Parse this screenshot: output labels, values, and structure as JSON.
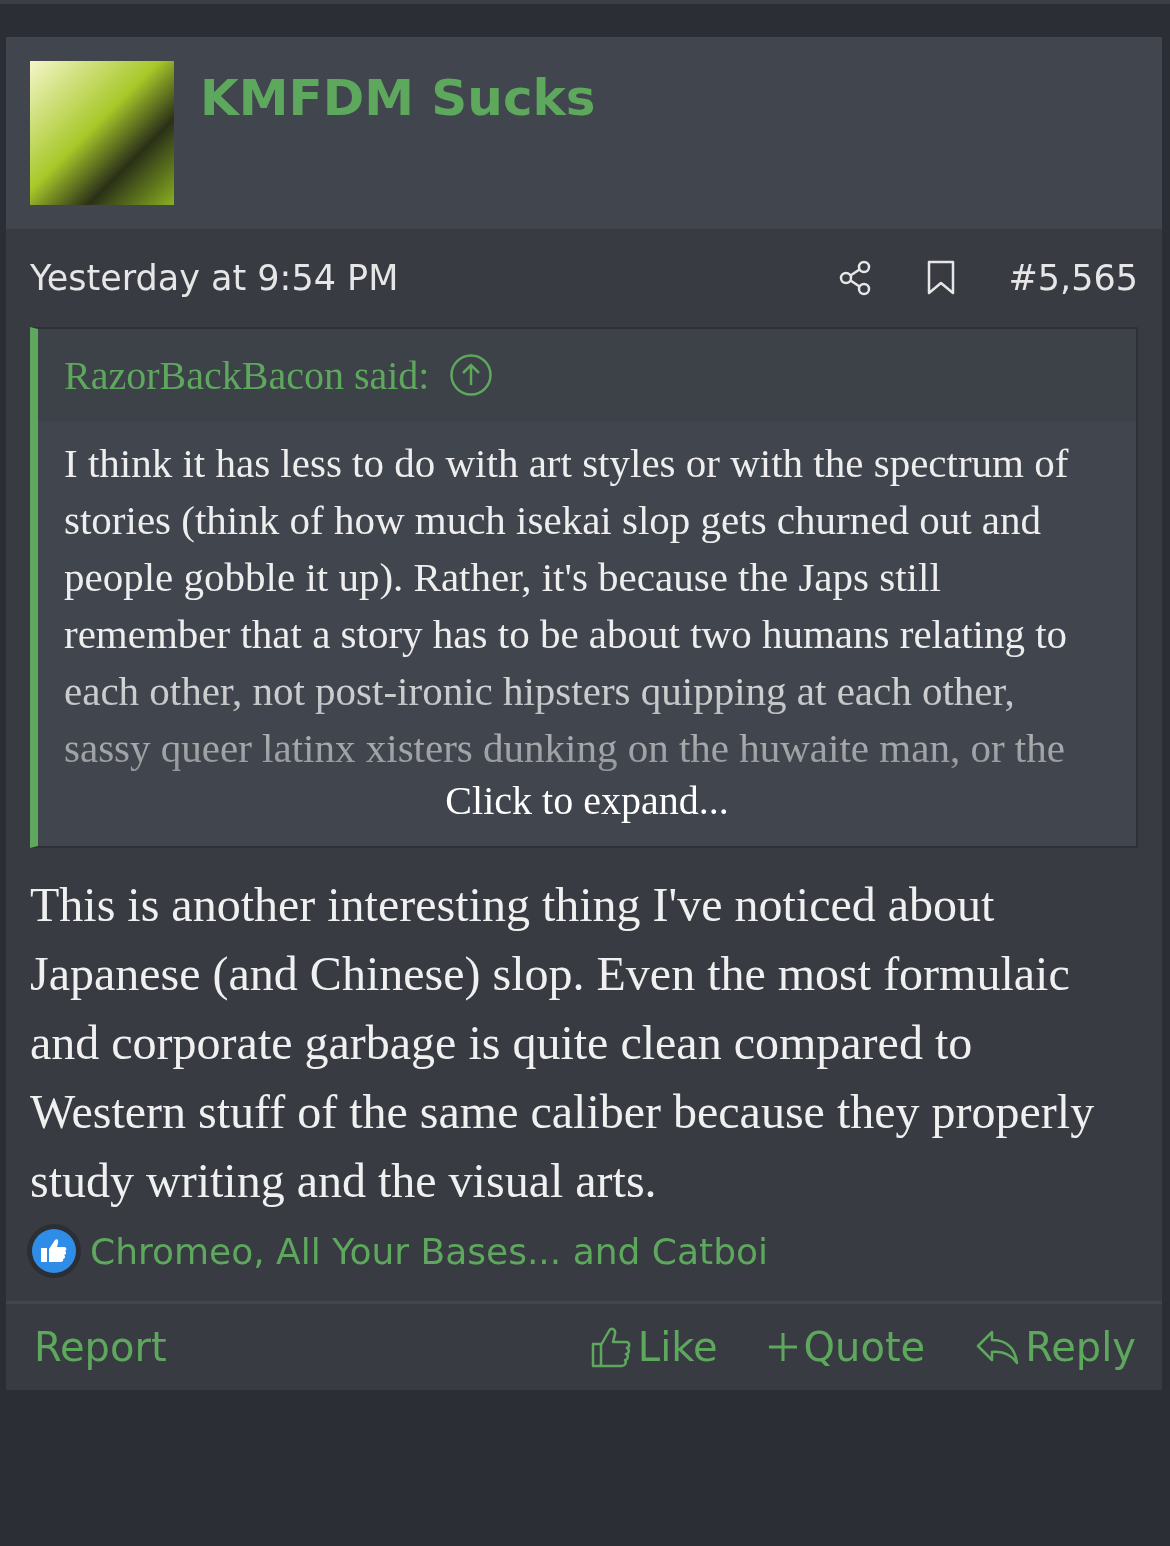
{
  "post": {
    "author": "KMFDM Sucks",
    "time": "Yesterday at 9:54 PM",
    "number": "#5,565",
    "quote": {
      "author": "RazorBackBacon said:",
      "text": "I think it has less to do with art styles or with the spectrum of stories (think of how much isekai slop gets churned out and people gobble it up). Rather, it's because the Japs still remember that a story has to be about two humans relating to each other, not post-ironic hipsters quipping at each other, sassy queer latinx xisters dunking on the huwaite man, or the",
      "expand": "Click to expand..."
    },
    "body": "This is another interesting thing I've noticed about Japanese (and Chinese) slop. Even the most formulaic and corporate garbage is quite clean compared to Western stuff of the same caliber because they properly study writing and the visual arts.",
    "reactions": "Chromeo, All Your Bases... and Catboi",
    "actions": [
      {
        "kind": "report",
        "label": "Report"
      },
      {
        "kind": "like",
        "label": "Like"
      },
      {
        "kind": "quote",
        "label": "Quote"
      },
      {
        "kind": "reply",
        "label": "Reply"
      }
    ]
  }
}
